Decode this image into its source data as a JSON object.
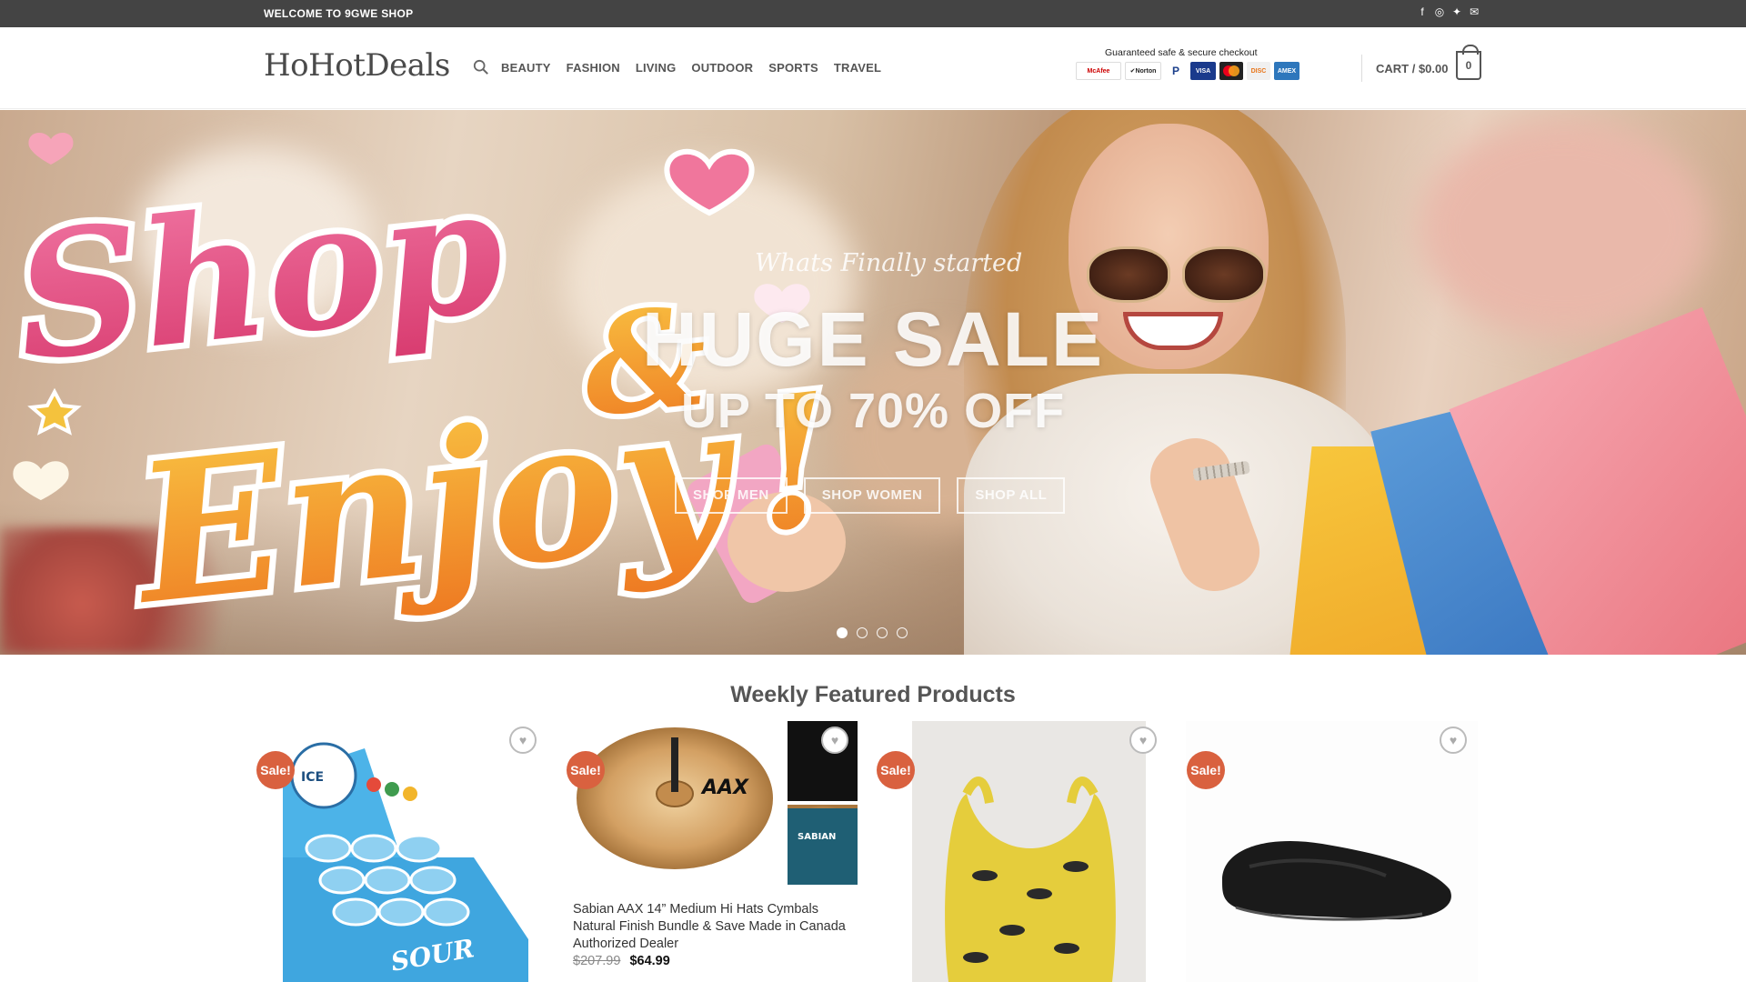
{
  "topbar": {
    "welcome": "WELCOME TO 9GWE SHOP",
    "social_icons": [
      "facebook-icon",
      "instagram-icon",
      "twitter-icon",
      "email-icon"
    ]
  },
  "header": {
    "logo": "HoHotDeals",
    "nav": [
      "BEAUTY",
      "FASHION",
      "LIVING",
      "OUTDOOR",
      "SPORTS",
      "TRAVEL"
    ],
    "secure_caption": "Guaranteed safe & secure checkout",
    "cart_label": "CART / $0.00",
    "cart_count": "0"
  },
  "hero": {
    "script_line": "Whats Finally started",
    "headline": "HUGE SALE",
    "subheadline": "UP TO 70% OFF",
    "buttons": [
      "SHOP MEN",
      "SHOP WOMEN",
      "SHOP ALL"
    ],
    "art_text_1": "Shop",
    "art_text_amp": "&",
    "art_text_2": "Enjoy",
    "art_text_3": "!",
    "slides": 4,
    "active_slide": 1
  },
  "featured": {
    "title": "Weekly Featured Products",
    "sale_label": "Sale!",
    "products": [
      {
        "name": "",
        "old_price": "",
        "new_price": ""
      },
      {
        "name": "Sabian AAX 14” Medium Hi Hats Cymbals Natural Finish Bundle & Save Made in Canada Authorized Dealer",
        "old_price": "$207.99",
        "new_price": "$64.99"
      },
      {
        "name": "",
        "old_price": "",
        "new_price": ""
      },
      {
        "name": "",
        "old_price": "",
        "new_price": ""
      }
    ]
  },
  "colors": {
    "topbar_bg": "#444444",
    "sale_badge": "#d9613f",
    "shop_pink": "#e0447c",
    "enjoy_orange": "#f4a23a"
  }
}
